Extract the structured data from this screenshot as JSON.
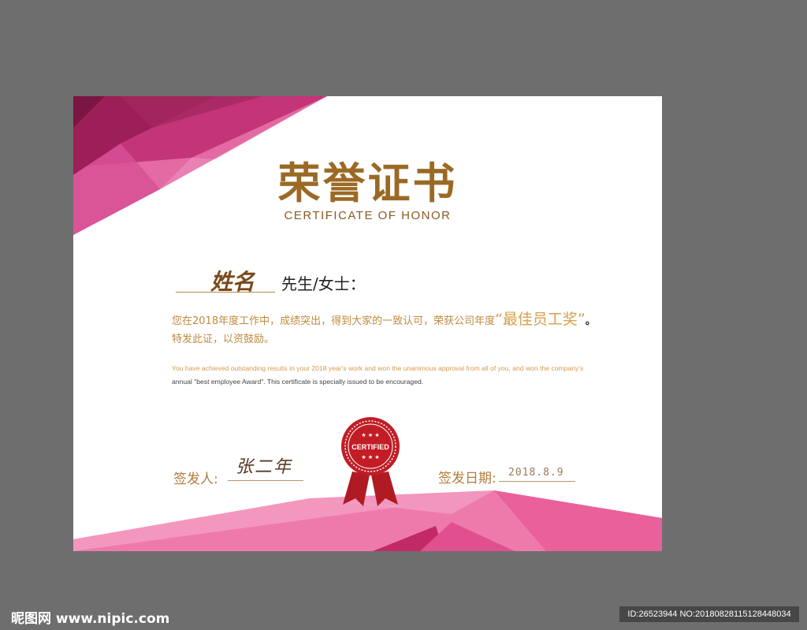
{
  "certificate": {
    "title": "荣誉证书",
    "subtitle": "CERTIFICATE OF HONOR",
    "name_script": "姓名",
    "salutation": "先生/女士：",
    "body_cn_line1": "您在2018年度工作中，成绩突出，得到大家的一致认可，荣获公司年度",
    "award": "“最佳员工奖”",
    "body_cn_tail": "。",
    "body_cn_line2": "特发此证，以资鼓励。",
    "body_en_a": "You have achieved outstanding results in your 2018 year's work and won the unanimous approval from all of you, and won the company's",
    "body_en_b1": "annual \"best employee Award\". This certificate is specially issued to be encouraged.",
    "signer_label": "签发人:",
    "signer_signature": "张二年",
    "date_label": "签发日期:",
    "date_value": "2018.8.9",
    "seal_text": "CERTIFIED",
    "colors": {
      "gold": "#9a6a25",
      "magenta": "#c42b72",
      "pink": "#e8609c",
      "seal_red": "#c21d26"
    }
  },
  "watermark": {
    "site": "昵图网 www.nipic.com",
    "id_text": "ID:26523944 NO:20180828115128448034"
  }
}
